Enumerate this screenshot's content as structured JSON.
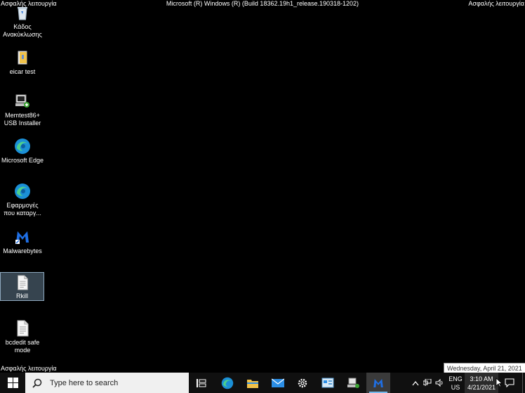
{
  "watermark": {
    "top_left": "Ασφαλής λειτουργία",
    "top_center": "Microsoft (R) Windows (R) (Build 18362.19h1_release.190318-1202)",
    "top_right": "Ασφαλής λειτουργία",
    "bottom_left": "Ασφαλής λειτουργία"
  },
  "desktop_icons": [
    {
      "line1": "Κάδος",
      "line2": "Ανακύκλωσης",
      "icon": "recycle-bin-icon"
    },
    {
      "line1": "eicar test",
      "line2": "",
      "icon": "folder-icon"
    },
    {
      "line1": "Memtest86+",
      "line2": "USB Installer",
      "icon": "installer-icon"
    },
    {
      "line1": "Microsoft Edge",
      "line2": "",
      "icon": "edge-icon"
    },
    {
      "line1": "Εφαρμογές",
      "line2": "που καταργ...",
      "icon": "edge-apps-icon"
    },
    {
      "line1": "Malwarebytes",
      "line2": "",
      "icon": "malwarebytes-icon"
    },
    {
      "line1": "Rkill",
      "line2": "",
      "icon": "document-icon"
    },
    {
      "line1": "bcdedit safe",
      "line2": "mode",
      "icon": "document-icon"
    }
  ],
  "tooltip": "Wednesday, April 21, 2021",
  "taskbar": {
    "search_placeholder": "Type here to search",
    "apps": [
      "task-view-icon",
      "edge-icon",
      "file-explorer-icon",
      "mail-icon",
      "settings-icon",
      "control-panel-icon",
      "usb-installer-icon",
      "malwarebytes-icon"
    ],
    "lang_line1": "ENG",
    "lang_line2": "US",
    "time": "3:10 AM",
    "date": "4/21/2021"
  }
}
